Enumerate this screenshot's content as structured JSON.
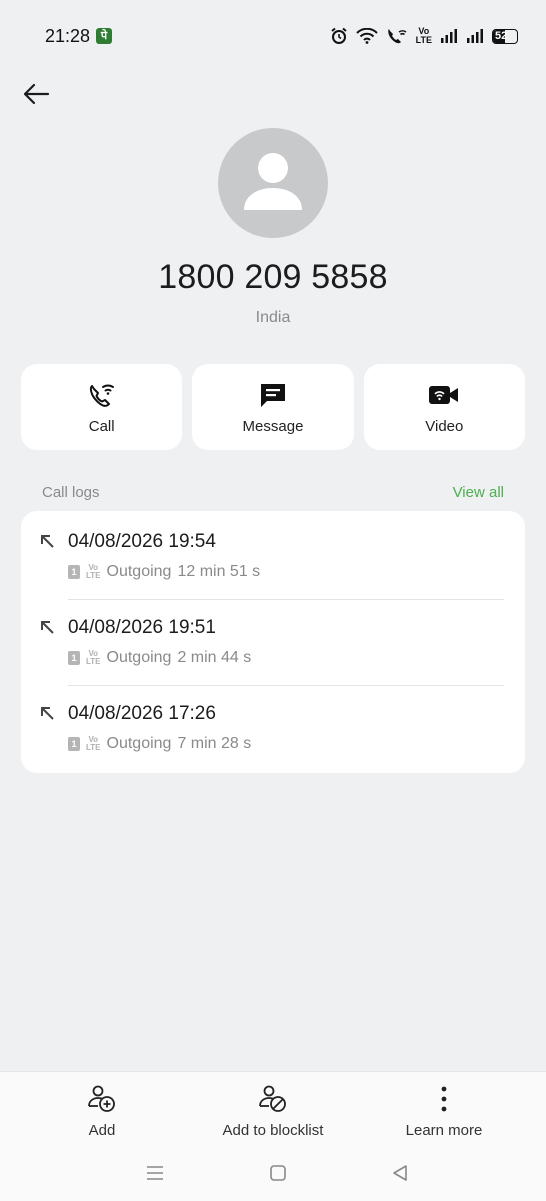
{
  "status_bar": {
    "time": "21:28",
    "app_icon_glyph": "पे",
    "volte": [
      "Vo",
      "LTE"
    ],
    "battery_level": "52",
    "battery_percent": 52
  },
  "contact": {
    "number": "1800 209 5858",
    "location": "India"
  },
  "actions": [
    {
      "label": "Call",
      "icon": "wifi-call-icon"
    },
    {
      "label": "Message",
      "icon": "message-icon"
    },
    {
      "label": "Video",
      "icon": "video-icon"
    }
  ],
  "call_logs": {
    "title": "Call logs",
    "view_all": "View all",
    "sim_label": "1",
    "volte_label": [
      "Vo",
      "LTE"
    ],
    "entries": [
      {
        "datetime": "04/08/2026 19:54",
        "type": "Outgoing",
        "duration": "12 min 51 s"
      },
      {
        "datetime": "04/08/2026 19:51",
        "type": "Outgoing",
        "duration": "2 min 44 s"
      },
      {
        "datetime": "04/08/2026 17:26",
        "type": "Outgoing",
        "duration": "7 min 28 s"
      }
    ]
  },
  "bottom_actions": [
    {
      "label": "Add",
      "icon": "add-contact-icon"
    },
    {
      "label": "Add to blocklist",
      "icon": "block-contact-icon"
    },
    {
      "label": "Learn more",
      "icon": "more-vertical-icon"
    }
  ],
  "nav_bar": [
    "menu-icon",
    "home-icon",
    "back-triangle-icon"
  ],
  "colors": {
    "background": "#eff0f2",
    "card": "#ffffff",
    "accent_green": "#4caf50",
    "muted_text": "#8a8a8a"
  }
}
